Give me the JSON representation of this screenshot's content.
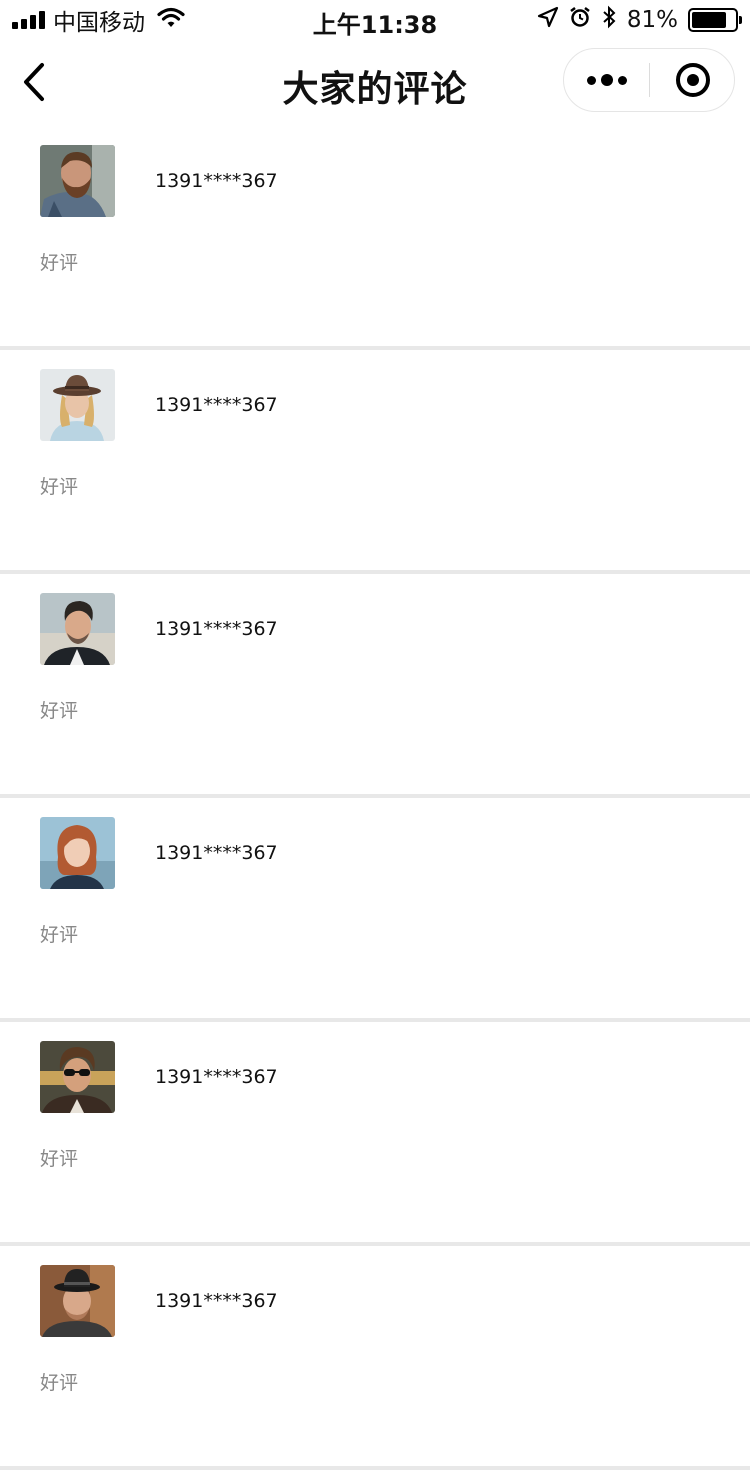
{
  "status_bar": {
    "carrier": "中国移动",
    "time": "上午11:38",
    "battery_percent": "81%",
    "battery_level": 0.81,
    "icons": [
      "signal-icon",
      "wifi-icon",
      "location-icon",
      "alarm-icon",
      "bluetooth-icon",
      "battery-icon"
    ]
  },
  "nav": {
    "title": "大家的评论",
    "icons": [
      "back-icon",
      "more-icon",
      "close-target-icon"
    ]
  },
  "comments": [
    {
      "user": "1391****367",
      "text": "好评",
      "avatar": "avatar-bearded-man"
    },
    {
      "user": "1391****367",
      "text": "好评",
      "avatar": "avatar-woman-hat"
    },
    {
      "user": "1391****367",
      "text": "好评",
      "avatar": "avatar-young-man"
    },
    {
      "user": "1391****367",
      "text": "好评",
      "avatar": "avatar-redhead-woman"
    },
    {
      "user": "1391****367",
      "text": "好评",
      "avatar": "avatar-man-sunglasses"
    },
    {
      "user": "1391****367",
      "text": "好评",
      "avatar": "avatar-man-hat"
    }
  ],
  "colors": {
    "background": "#ffffff",
    "divider": "#e8e8e8",
    "secondary_text": "#888888"
  }
}
